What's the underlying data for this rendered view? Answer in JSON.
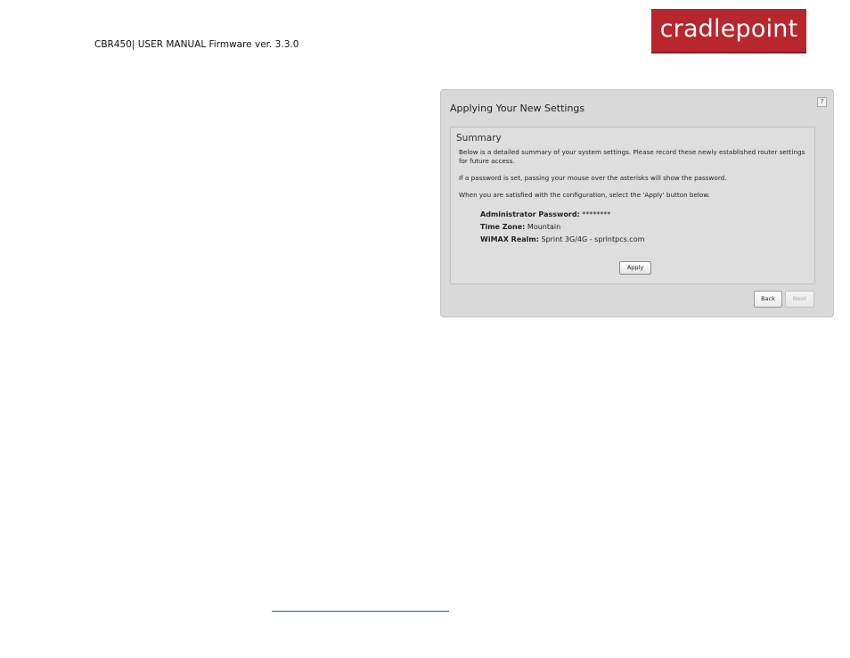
{
  "header": {
    "manual_title": "CBR450| USER MANUAL Firmware ver. 3.3.0"
  },
  "logo": {
    "text": "cradlepoint",
    "color": "#b8262e"
  },
  "dialog": {
    "title": "Applying Your New Settings",
    "help_label": "?",
    "summary": {
      "title": "Summary",
      "paragraphs": [
        "Below is a detailed summary of your system settings. Please record these newly established router settings for future access.",
        "If a password is set, passing your mouse over the asterisks will show the password.",
        "When you are satisfied with the configuration, select the 'Apply' button below."
      ],
      "settings": [
        {
          "label": "Administrator Password:",
          "value": "********"
        },
        {
          "label": "Time Zone:",
          "value": "Mountain"
        },
        {
          "label": "WiMAX Realm:",
          "value": "Sprint 3G/4G - sprintpcs.com"
        }
      ],
      "apply_label": "Apply"
    },
    "back_label": "Back",
    "next_label": "Next"
  },
  "footer": {
    "link_text": ""
  }
}
